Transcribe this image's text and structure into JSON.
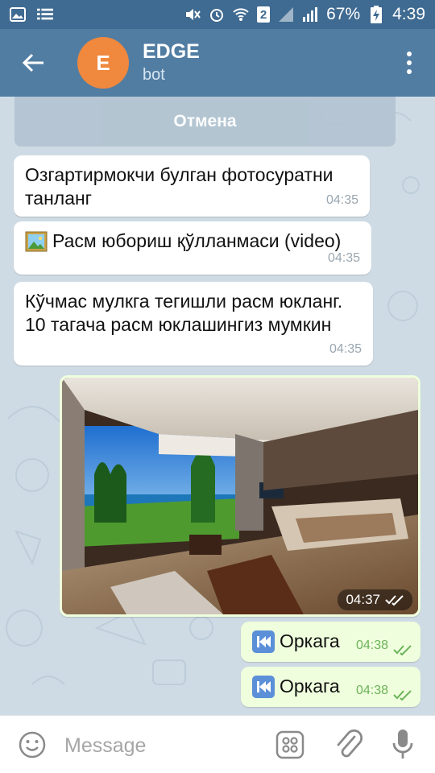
{
  "status_bar": {
    "battery_percent": "67%",
    "time": "4:39",
    "sim_badge": "2"
  },
  "header": {
    "avatar_letter": "E",
    "title": "EDGE",
    "subtitle": "bot"
  },
  "chat": {
    "cancel_label": "Отмена",
    "messages": [
      {
        "text": "Озгартирмокчи булган фотосуратни танланг",
        "time": "04:35"
      },
      {
        "text": "Расм юбориш қўлланмаси (video)",
        "time": "04:35"
      },
      {
        "text": "Кўчмас мулкга тегишли расм юкланг. 10 тагача расм юклашингиз мумкин",
        "time": "04:35"
      }
    ],
    "photo_message": {
      "time": "04:37"
    },
    "outgoing": [
      {
        "text": "Оркага",
        "time": "04:38"
      },
      {
        "text": "Оркага",
        "time": "04:38"
      }
    ]
  },
  "input": {
    "placeholder": "Message"
  },
  "colors": {
    "header_bg": "#527da3",
    "status_bg": "#3f6a91",
    "avatar_bg": "#f0883e",
    "outgoing_bubble": "#effedd",
    "read_check": "#6cb35a"
  }
}
